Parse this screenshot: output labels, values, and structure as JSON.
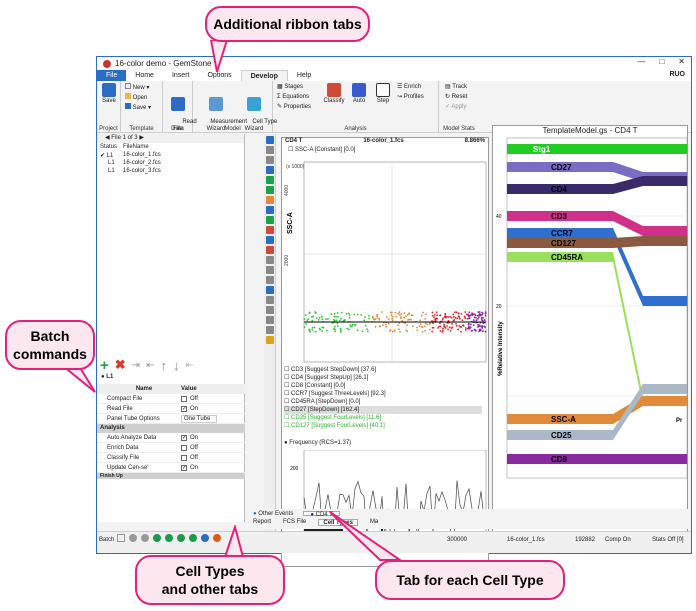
{
  "callouts": {
    "ribbon": "Additional ribbon tabs",
    "batch": "Batch\ncommands",
    "celltypes": "Cell Types\nand other tabs",
    "tab_each": "Tab for each Cell Type"
  },
  "window": {
    "title": "16-color demo - GemStone",
    "user": "RUO"
  },
  "ribbon_tabs": [
    "File",
    "Home",
    "Insert",
    "Options",
    "Develop",
    "Help"
  ],
  "ribbon": {
    "project": {
      "label": "Project",
      "save": "Save"
    },
    "template": {
      "label": "Template",
      "new": "New",
      "open": "Open",
      "save": "Save"
    },
    "data": {
      "label": "Data",
      "read_file": "Read\nFile"
    },
    "model": {
      "label": "Model",
      "measurement": "Measurement\nWizard",
      "celltype": "Cell Type\nWizard"
    },
    "analysis": {
      "label": "Analysis",
      "stages": "Stages",
      "equations": "Equations",
      "properties": "Properties",
      "classify": "Classify",
      "auto": "Auto",
      "step": "Step",
      "enrich": "Enrich",
      "profiles": "Profiles"
    },
    "modelstats": {
      "label": "Model Stats",
      "track": "Track",
      "reset": "Reset",
      "apply": "Apply"
    }
  },
  "files": {
    "header": "File 1 of 3",
    "col_status": "Status",
    "col_filename": "FileName",
    "rows": [
      {
        "status": "L1",
        "name": "16-color_1.fcs"
      },
      {
        "status": "L1",
        "name": "16-color_2.fcs"
      },
      {
        "status": "L1",
        "name": "16-color_3.fcs"
      }
    ]
  },
  "batch_label": "L1",
  "props": {
    "col_name": "Name",
    "col_value": "Value",
    "rows": [
      {
        "name": "Compact File",
        "value": "Off",
        "checked": false
      },
      {
        "name": "Read File",
        "value": "On",
        "checked": true
      },
      {
        "name": "Panel Tube Options",
        "value": "One Tube",
        "checked": null
      }
    ],
    "analysis_section": "Analysis",
    "analysis_rows": [
      {
        "name": "Auto Analyze Data",
        "value": "On",
        "checked": true
      },
      {
        "name": "Enrich Data",
        "value": "Off",
        "checked": false
      },
      {
        "name": "Classify File",
        "value": "Off",
        "checked": false
      },
      {
        "name": "Update Cen-se'",
        "value": "On",
        "checked": true
      }
    ],
    "next_section": "Finish Up"
  },
  "plot1": {
    "title": "CD4 T",
    "file": "16-color_1.fcs",
    "pct": "8.866%",
    "param": "SSC-A [Constant] [0.0]",
    "ylabel": "SSC-A",
    "yscale": "(x 1000)",
    "yticks": [
      "4000",
      "2000"
    ],
    "legend": [
      {
        "text": "CD3 [Suggest StepDown] [37.6]",
        "color": "#222"
      },
      {
        "text": "CD4 [Suggest StepUp] [26.1]",
        "color": "#222"
      },
      {
        "text": "CD8 [Constant] [0.0]",
        "color": "#222"
      },
      {
        "text": "CCR7 [Suggest ThreeLevels] [92.3]",
        "color": "#222"
      },
      {
        "text": "CD45RA [StepDown] [0.0]",
        "color": "#222"
      },
      {
        "text": "CD27 [StepDown] [162.4]",
        "color": "#222"
      },
      {
        "text": "CD25 [Suggest FourLevels] [11.6]",
        "color": "#2bb02b"
      },
      {
        "text": "CD127 [Suggest FourLevels] [40.1]",
        "color": "#2bb02b"
      }
    ],
    "freq": "Frequency (RCS=1.37)",
    "freq_tick": "200"
  },
  "plot2": {
    "title": "TemplateModel.gs - CD4 T",
    "ylabel": "%Relative Intensity",
    "yticks": [
      "40",
      "20"
    ],
    "xlabel_partial": "Pr",
    "bands": [
      {
        "label": "Stg1",
        "color": "#22cc22"
      },
      {
        "label": "CD27",
        "color": "#7a6cc4"
      },
      {
        "label": "CD4",
        "color": "#3a2a6a"
      },
      {
        "label": "CD3",
        "color": "#d0308a"
      },
      {
        "label": "CCR7",
        "color": "#2f6fd0"
      },
      {
        "label": "CD127",
        "color": "#8a5a40"
      },
      {
        "label": "CD45RA",
        "color": "#9be05a"
      },
      {
        "label": "SSC-A",
        "color": "#e08a3a"
      },
      {
        "label": "CD25",
        "color": "#aab8c8"
      },
      {
        "label": "CD8",
        "color": "#8a2aa0"
      }
    ]
  },
  "bottom_tabs": {
    "row1": [
      "Other Events",
      "CD4 T"
    ],
    "row2": [
      "Report",
      "FCS File",
      "Cell Types",
      "Ma"
    ]
  },
  "status": {
    "batch": "Batch",
    "events": "300000",
    "file": "16-color_1.fcs",
    "count": "192882",
    "comp": "Comp On",
    "stats": "Stats Off [0]"
  },
  "colors": {
    "accent": "#2b6cc4",
    "callout_border": "#e0227a",
    "callout_fill": "#fde7ef"
  }
}
